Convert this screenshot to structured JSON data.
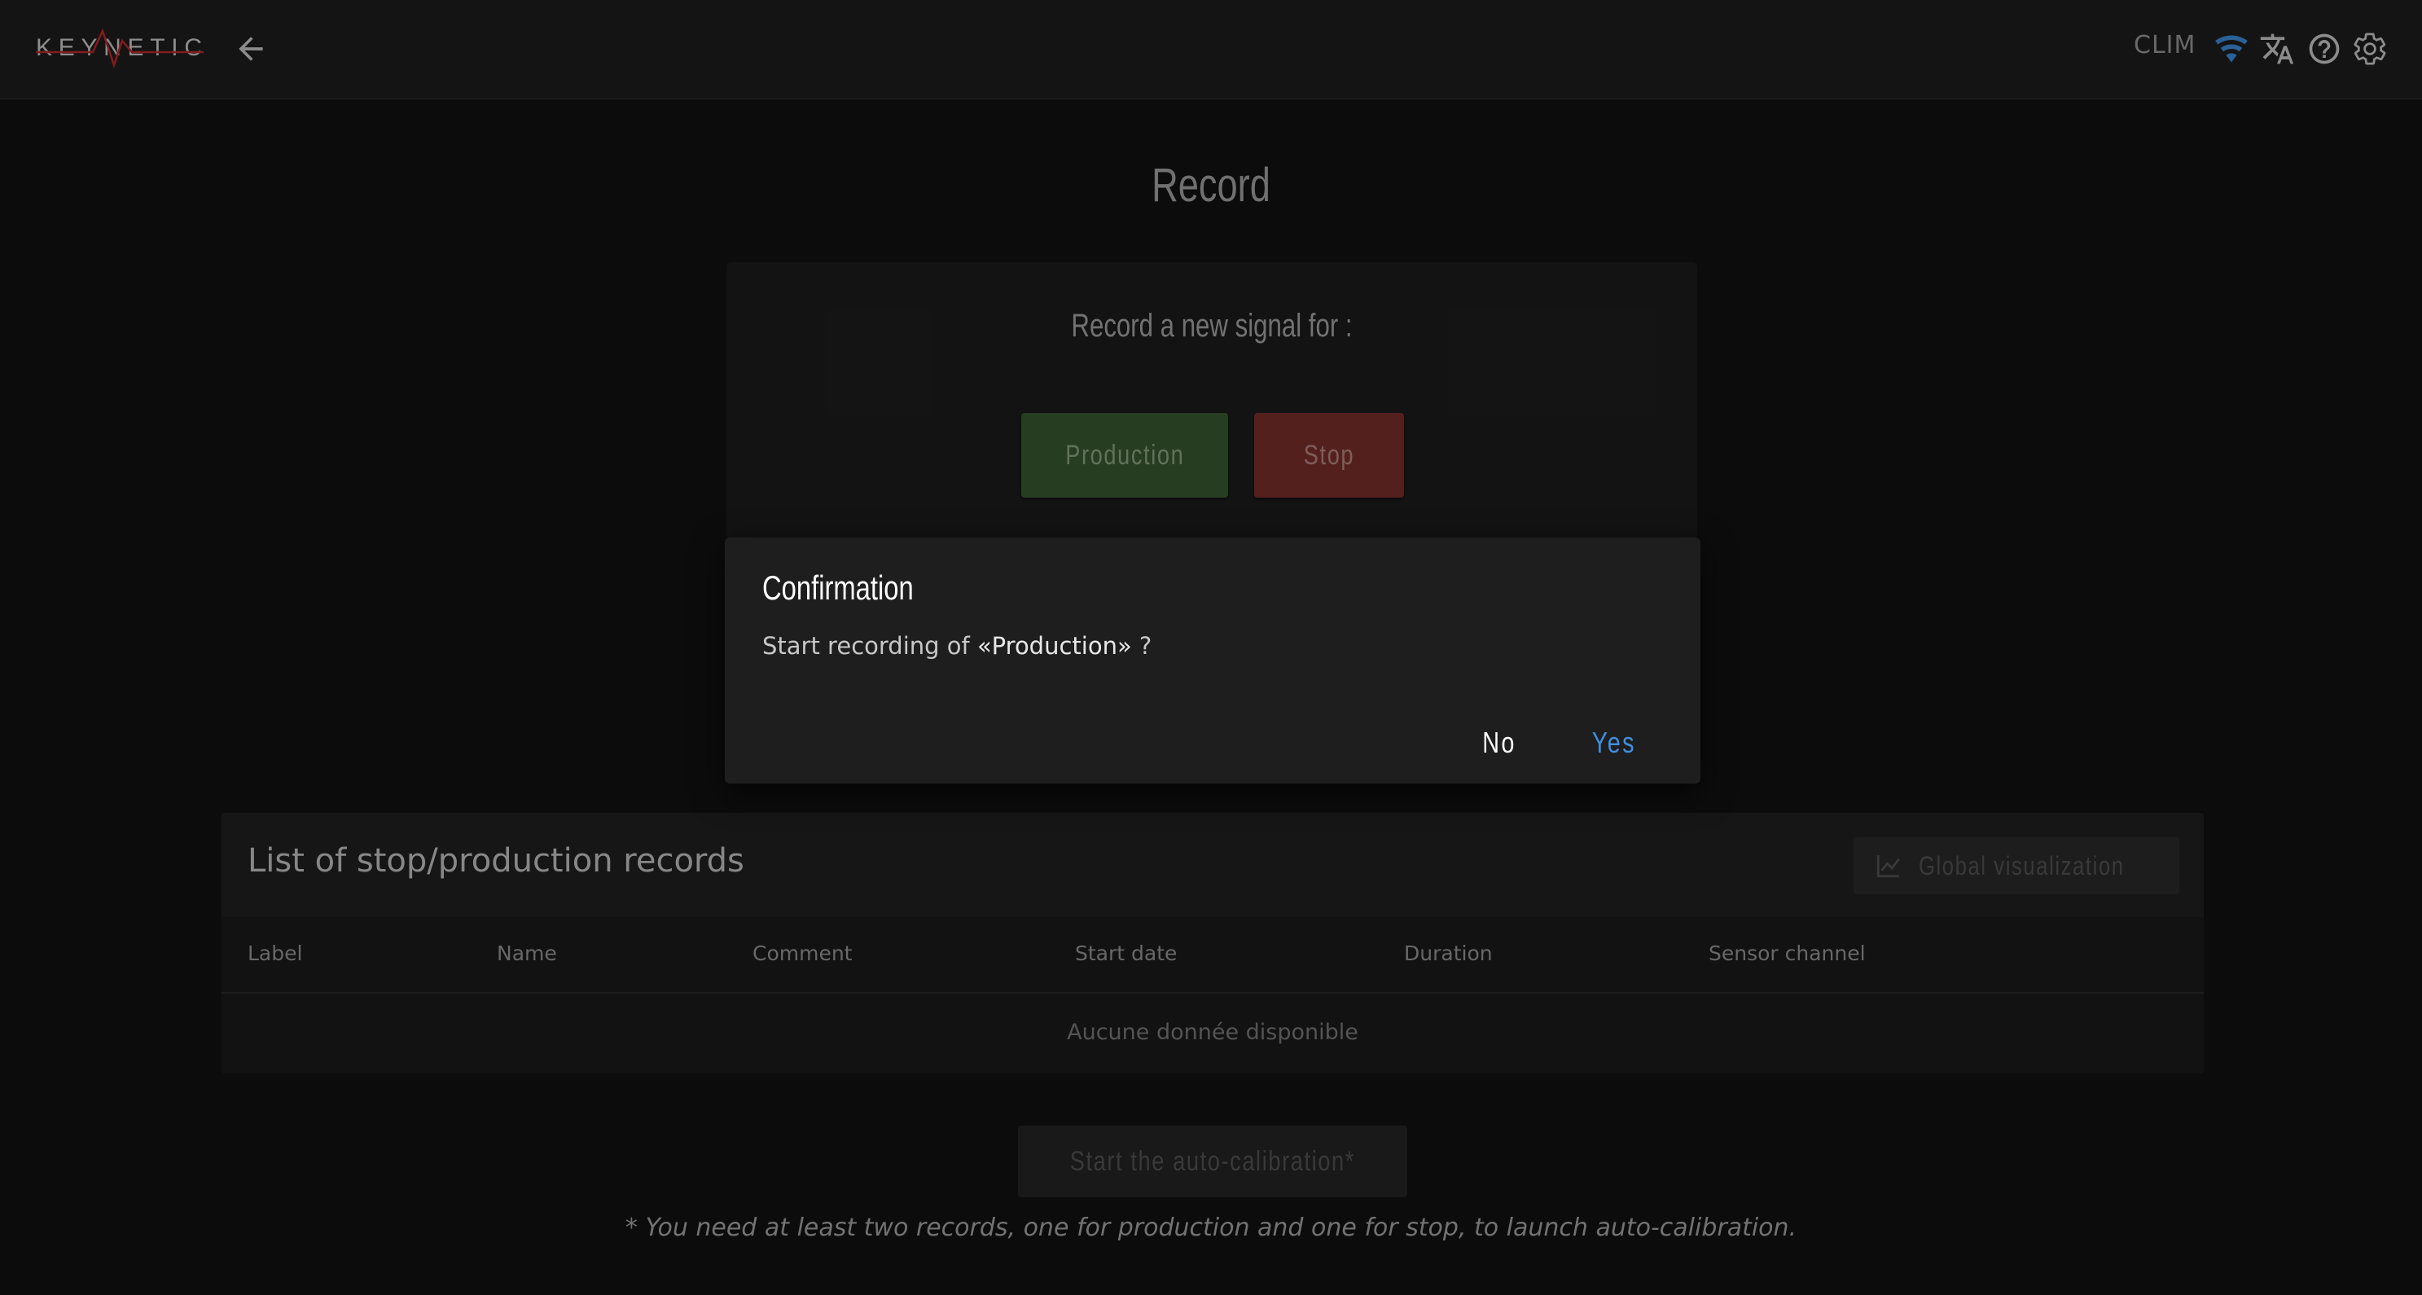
{
  "header": {
    "logo_text": "KEYNETIC",
    "plant": "CLIM",
    "icons": [
      "arrow-left-icon",
      "wifi-icon",
      "translate-icon",
      "help-icon",
      "gear-icon"
    ],
    "accent_color": "#3f8fe0"
  },
  "page": {
    "title": "Record"
  },
  "record_card": {
    "subtitle": "Record a new signal for :",
    "production_label": "Production",
    "stop_label": "Stop",
    "production_color": "#3a5a32",
    "stop_color": "#7c302d"
  },
  "dialog": {
    "title": "Confirmation",
    "text_prefix": "Start recording of ",
    "text_target": "«Production»",
    "text_suffix": " ?",
    "no_label": "No",
    "yes_label": "Yes"
  },
  "records": {
    "title": "List of stop/production records",
    "global_button": "Global visualization",
    "columns": [
      "Label",
      "Name",
      "Comment",
      "Start date",
      "Duration",
      "Sensor channel"
    ],
    "empty_text": "Aucune donnée disponible"
  },
  "calibration": {
    "button_label": "Start the auto-calibration*",
    "note": "* You need at least two records, one for production and one for stop, to launch auto-calibration."
  }
}
